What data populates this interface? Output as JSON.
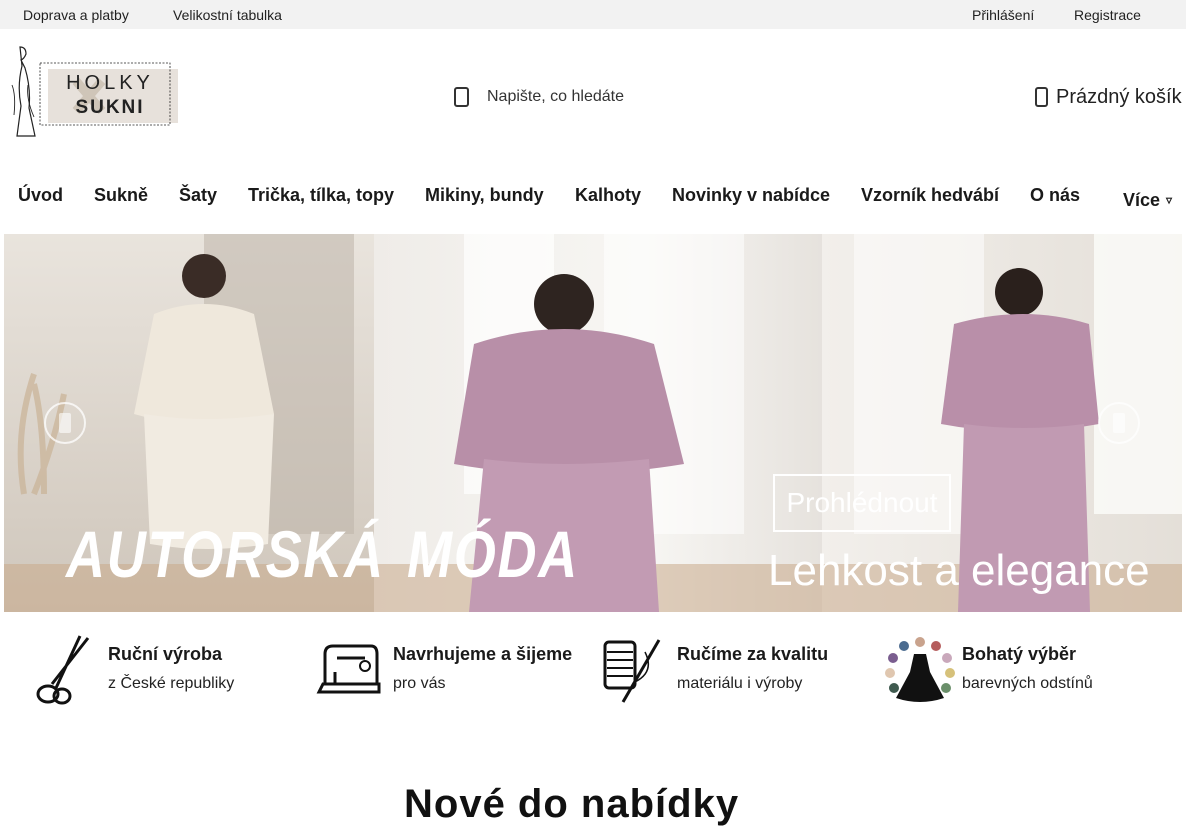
{
  "topbar": {
    "links_left": [
      "Doprava a platby",
      "Velikostní tabulka"
    ],
    "links_right": [
      "Přihlášení",
      "Registrace"
    ]
  },
  "logo": {
    "line1": "HOLKY",
    "line2": "SUKNI"
  },
  "search": {
    "placeholder": "Napište, co hledáte",
    "icon": "search-icon"
  },
  "cart": {
    "label": "Prázdný košík",
    "icon": "cart-icon"
  },
  "nav": {
    "items": [
      "Úvod",
      "Sukně",
      "Šaty",
      "Trička, tílka, topy",
      "Mikiny, bundy",
      "Kalhoty",
      "Novinky v nabídce",
      "Vzorník hedvábí",
      "O nás"
    ],
    "more": "Více"
  },
  "hero": {
    "headline_1": "AUTORSKÁ",
    "headline_2": "MÓDA",
    "cta": "Prohlédnout",
    "subline": "Lehkost a elegance"
  },
  "features": [
    {
      "title": "Ruční výroba",
      "subtitle": "z České republiky",
      "icon": "scissors-icon"
    },
    {
      "title": "Navrhujeme a šijeme",
      "subtitle": "pro vás",
      "icon": "sewing-machine-icon"
    },
    {
      "title": "Ručíme za kvalitu",
      "subtitle": "materiálu i výroby",
      "icon": "thread-needle-icon"
    },
    {
      "title": "Bohatý výběr",
      "subtitle": "barevných odstínů",
      "icon": "dress-palette-icon"
    }
  ],
  "section": {
    "heading_partial": "Nové do nabídky"
  },
  "colors": {
    "topbar_bg": "#f2f2f2",
    "text": "#1a1a1a",
    "hero_outfit": "#b88fa8"
  }
}
